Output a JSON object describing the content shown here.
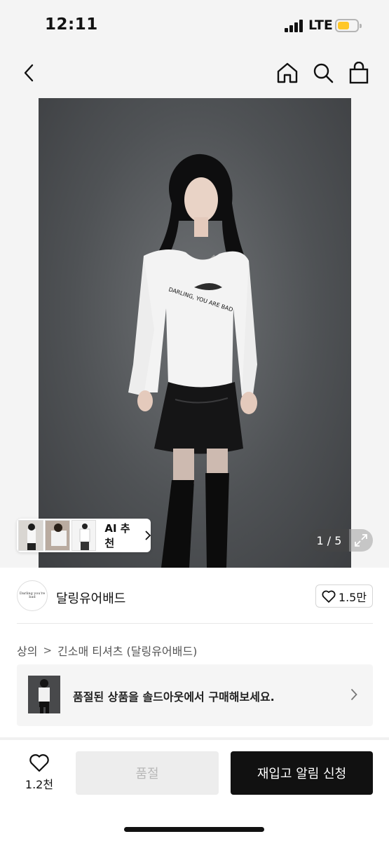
{
  "status_bar": {
    "time": "12:11",
    "network": "LTE",
    "battery_color": "#ffc727"
  },
  "header": {
    "back_icon": "chevron-left-icon",
    "home_icon": "home-icon",
    "search_icon": "search-icon",
    "cart_icon": "shopping-bag-icon"
  },
  "gallery": {
    "shirt_print": "DARLING, YOU ARE BAD",
    "ai_label": "AI 추천",
    "pager": "1 / 5",
    "expand_icon": "expand-icon"
  },
  "brand": {
    "logo_text": "Darling you're bad",
    "name": "달링유어배드",
    "likes": "1.5만"
  },
  "breadcrumb": {
    "items": [
      "상의",
      "긴소매 티셔츠 (달링유어배드)"
    ]
  },
  "banner": {
    "text": "품절된 상품을 솔드아웃에서 구매해보세요."
  },
  "bottom_bar": {
    "wish_count": "1.2천",
    "soldout_label": "품절",
    "notify_label": "재입고 알림 신청",
    "accent": "#111111"
  }
}
